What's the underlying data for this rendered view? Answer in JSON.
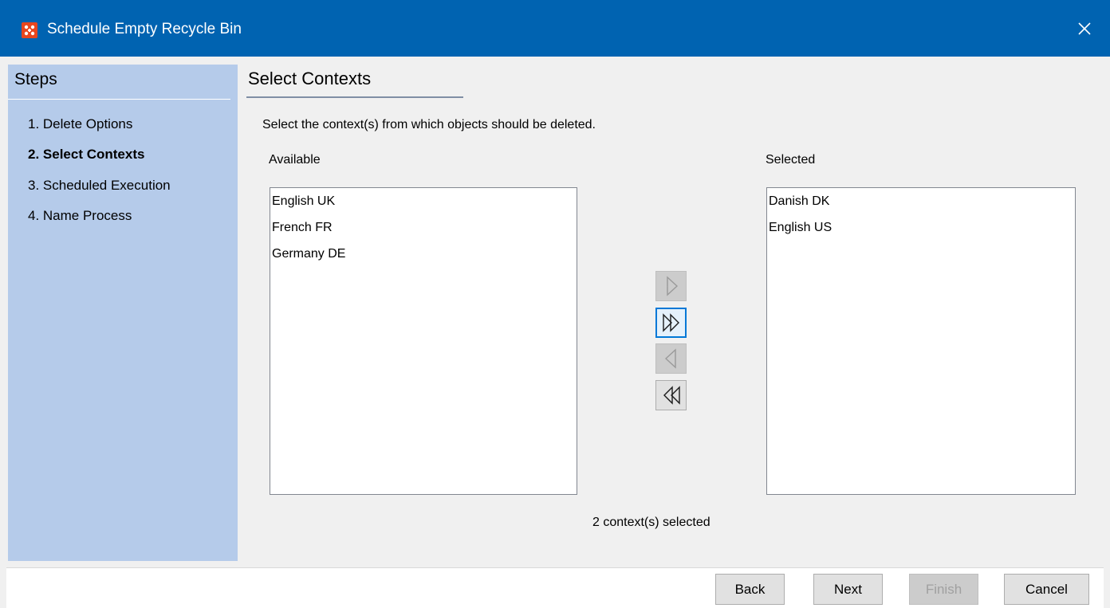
{
  "window": {
    "title": "Schedule Empty Recycle Bin",
    "title_bar_color": "#0063b1",
    "app_icon": "app-logo-icon",
    "close_icon": "close-icon"
  },
  "steps": {
    "title": "Steps",
    "items": [
      {
        "label": "1. Delete Options",
        "active": false
      },
      {
        "label": "2. Select Contexts",
        "active": true
      },
      {
        "label": "3. Scheduled Execution",
        "active": false
      },
      {
        "label": "4. Name Process",
        "active": false
      }
    ]
  },
  "main": {
    "section_title": "Select Contexts",
    "instruction": "Select the context(s) from which objects should be deleted.",
    "available_label": "Available",
    "selected_label": "Selected",
    "available_items": [
      "English UK",
      "French FR",
      "Germany DE"
    ],
    "selected_items": [
      "Danish DK",
      "English US"
    ],
    "status": "2 context(s) selected",
    "move_buttons": [
      {
        "name": "add-selected",
        "icon": "chevron-right-icon",
        "enabled": false
      },
      {
        "name": "add-all",
        "icon": "double-chevron-right-icon",
        "enabled": true,
        "focused": true
      },
      {
        "name": "remove-selected",
        "icon": "chevron-left-icon",
        "enabled": false
      },
      {
        "name": "remove-all",
        "icon": "double-chevron-left-icon",
        "enabled": true
      }
    ]
  },
  "footer": {
    "back_label": "Back",
    "next_label": "Next",
    "finish_label": "Finish",
    "cancel_label": "Cancel",
    "finish_enabled": false
  }
}
